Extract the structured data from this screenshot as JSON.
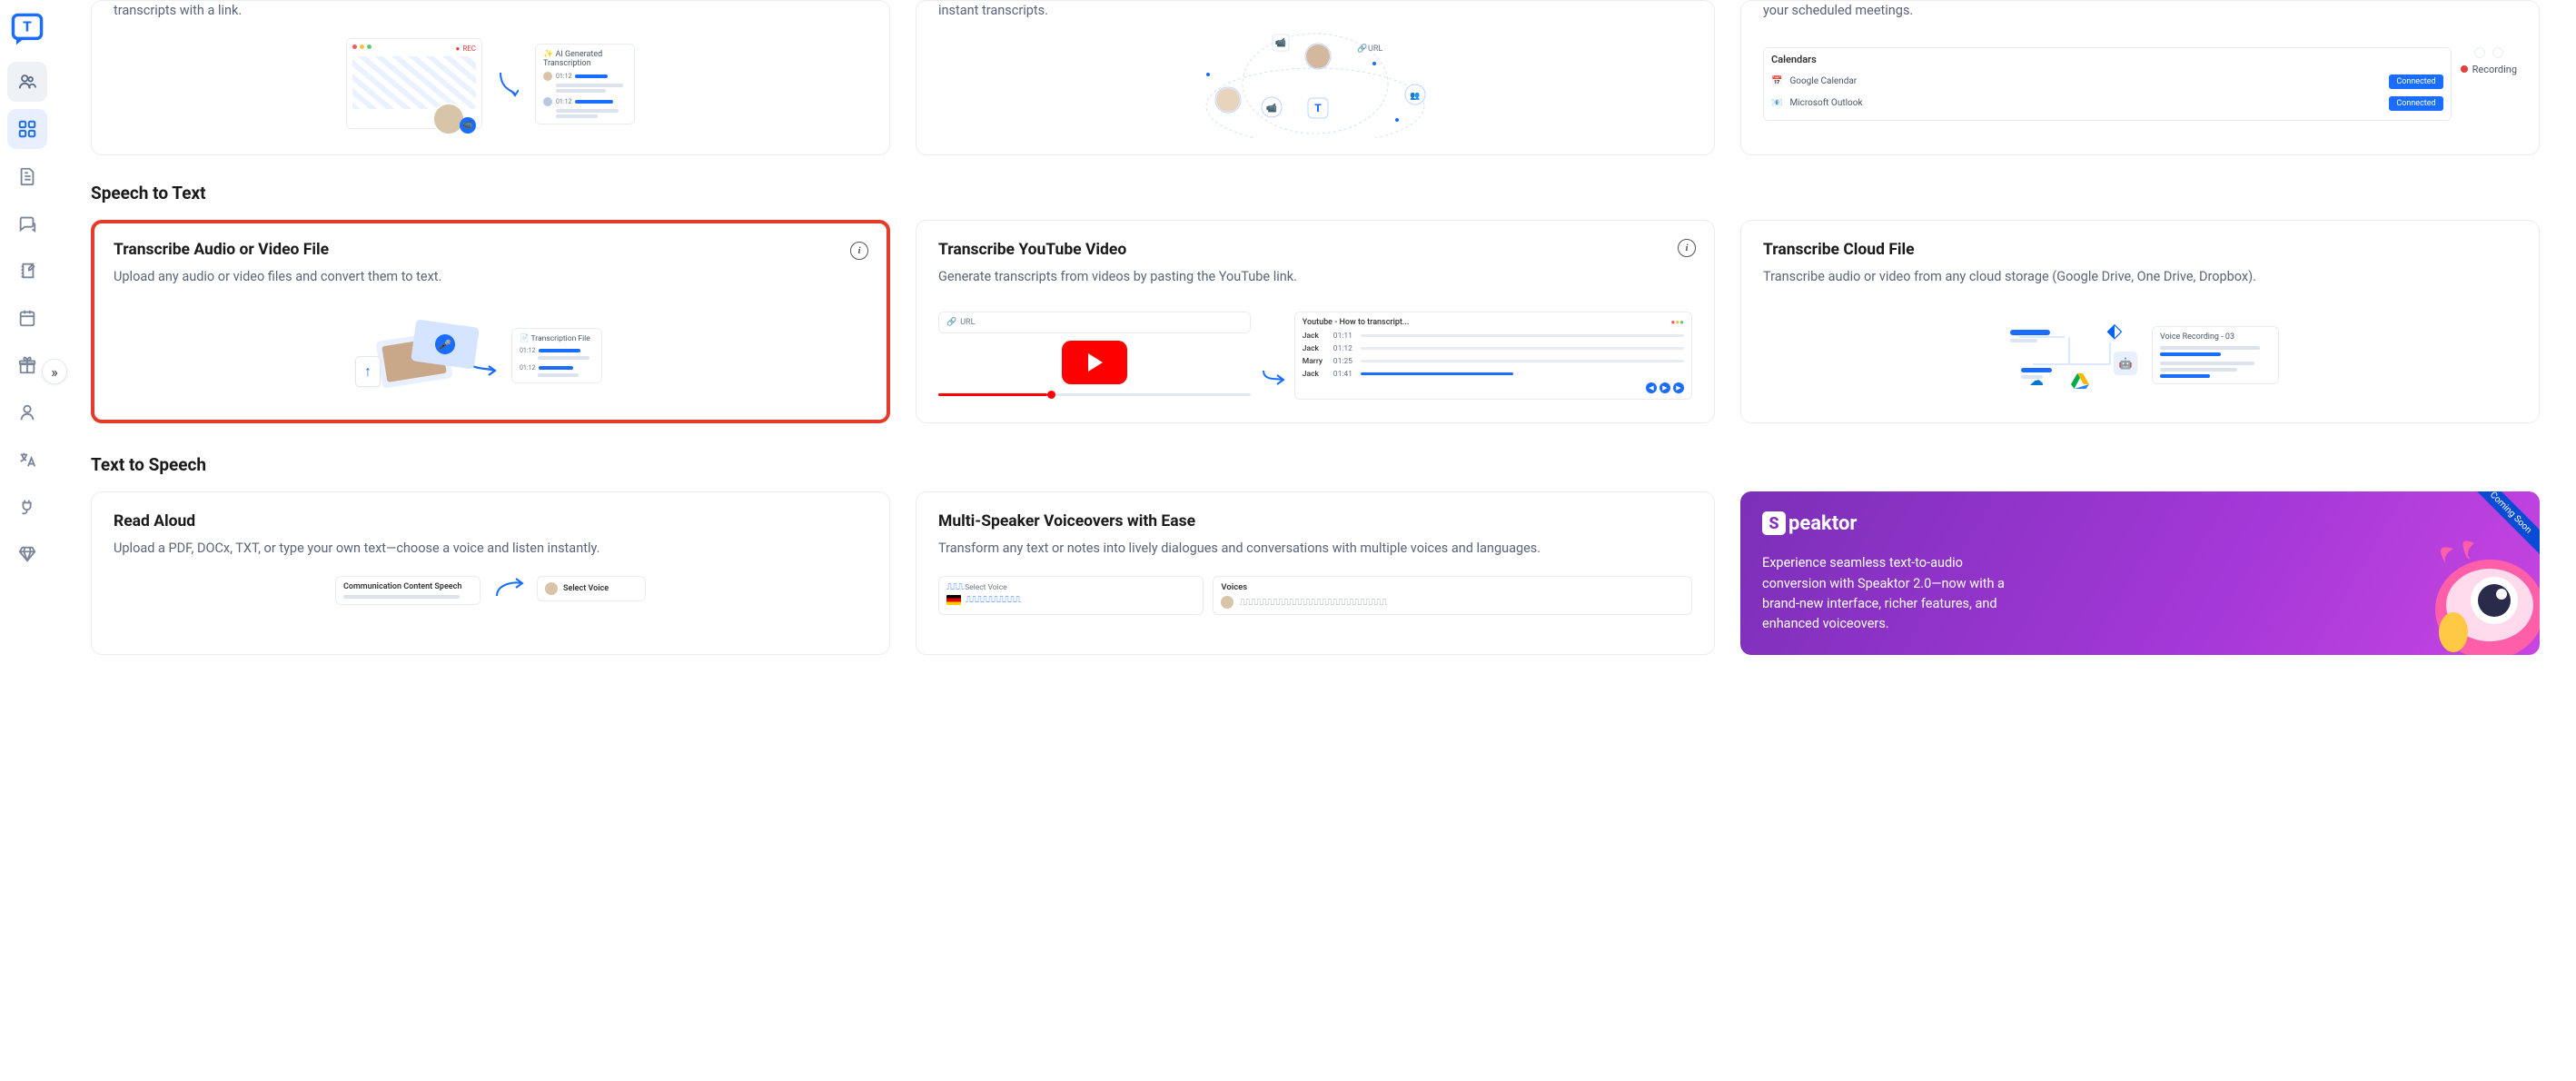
{
  "sidebar": {
    "expand_glyph": "»"
  },
  "top_cards": [
    {
      "desc_fragment": "transcripts with a link.",
      "illus_rec": "REC",
      "illus_caption": "AI Generated Transcription"
    },
    {
      "desc_fragment": "instant transcripts.",
      "illus_url_label": "URL"
    },
    {
      "desc_fragment": "your scheduled meetings.",
      "cal_title": "Calendars",
      "cal_google": "Google Calendar",
      "cal_outlook": "Microsoft Outlook",
      "connected": "Connected",
      "recording": "Recording"
    }
  ],
  "sections": {
    "stt": "Speech to Text",
    "tts": "Text to Speech"
  },
  "stt_cards": [
    {
      "title": "Transcribe Audio or Video File",
      "desc": "Upload any audio or video files and convert them to text.",
      "illus_label": "Transcription File",
      "t1": "01:12",
      "t2": "01:12"
    },
    {
      "title": "Transcribe YouTube Video",
      "desc": "Generate transcripts from videos by pasting the YouTube link.",
      "url_label": "URL",
      "yt_panel_title": "Youtube - How to transcript...",
      "rows": [
        {
          "name": "Jack",
          "time": "01:11"
        },
        {
          "name": "Jack",
          "time": "01:12"
        },
        {
          "name": "Marry",
          "time": "01:25"
        },
        {
          "name": "Jack",
          "time": "01:41"
        }
      ]
    },
    {
      "title": "Transcribe Cloud File",
      "desc": "Transcribe audio or video from any cloud storage (Google Drive, One Drive, Dropbox).",
      "illus_label": "Voice Recording - 03"
    }
  ],
  "tts_cards": [
    {
      "title": "Read Aloud",
      "desc": "Upload a PDF, DOCx, TXT, or type your own text—choose a voice and listen instantly.",
      "illus_left": "Communication Content Speech",
      "illus_right": "Select Voice"
    },
    {
      "title": "Multi-Speaker Voiceovers with Ease",
      "desc": "Transform any text or notes into lively dialogues and conversations with multiple voices and languages.",
      "select_voice": "Select Voice",
      "voices": "Voices"
    }
  ],
  "promo": {
    "brand_prefix": "S",
    "brand_rest": "peaktor",
    "desc": "Experience seamless text-to-audio conversion with Speaktor 2.0—now with a brand-new interface, richer features, and enhanced voiceovers.",
    "badge": "Coming Soon"
  }
}
